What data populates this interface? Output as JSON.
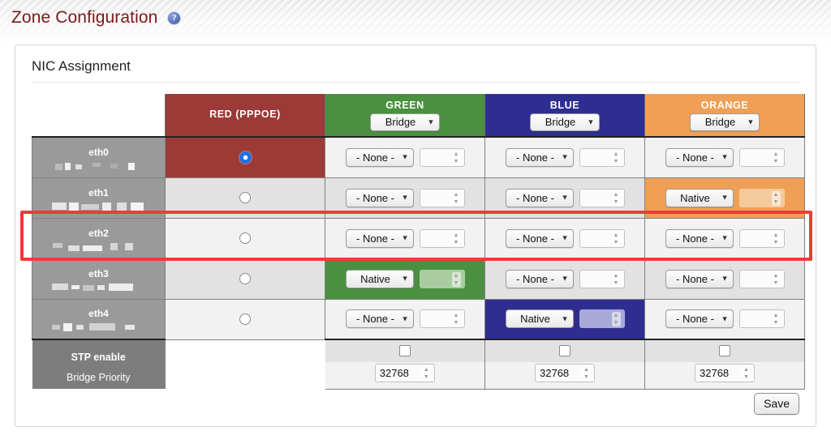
{
  "page": {
    "title": "Zone Configuration",
    "help_icon": "help-circle-icon"
  },
  "card": {
    "section_title": "NIC Assignment",
    "save_label": "Save"
  },
  "table": {
    "blank_header": "",
    "zones": [
      {
        "key": "red",
        "name": "RED (PPPOE)",
        "color": "#9c3a38",
        "has_mode_select": false,
        "mode_value": ""
      },
      {
        "key": "green",
        "name": "GREEN",
        "color": "#4a9040",
        "has_mode_select": true,
        "mode_value": "Bridge"
      },
      {
        "key": "blue",
        "name": "BLUE",
        "color": "#2e2e91",
        "has_mode_select": true,
        "mode_value": "Bridge"
      },
      {
        "key": "orange",
        "name": "ORANGE",
        "color": "#efa056",
        "has_mode_select": true,
        "mode_value": "Bridge"
      }
    ],
    "mode_options": [
      "Bridge"
    ],
    "vlan_options": [
      "- None -",
      "Native"
    ],
    "rows": [
      {
        "nic": "eth0",
        "mac_redacted": true,
        "red_selected": true,
        "green": {
          "select": "- None -",
          "vlan": "",
          "active": false
        },
        "blue": {
          "select": "- None -",
          "vlan": "",
          "active": false
        },
        "orange": {
          "select": "- None -",
          "vlan": "",
          "active": false
        }
      },
      {
        "nic": "eth1",
        "mac_redacted": true,
        "red_selected": false,
        "green": {
          "select": "- None -",
          "vlan": "",
          "active": false
        },
        "blue": {
          "select": "- None -",
          "vlan": "",
          "active": false
        },
        "orange": {
          "select": "Native",
          "vlan": "",
          "active": true
        }
      },
      {
        "nic": "eth2",
        "mac_redacted": true,
        "red_selected": false,
        "green": {
          "select": "- None -",
          "vlan": "",
          "active": false
        },
        "blue": {
          "select": "- None -",
          "vlan": "",
          "active": false
        },
        "orange": {
          "select": "- None -",
          "vlan": "",
          "active": false
        }
      },
      {
        "nic": "eth3",
        "mac_redacted": true,
        "red_selected": false,
        "green": {
          "select": "Native",
          "vlan": "",
          "active": true
        },
        "blue": {
          "select": "- None -",
          "vlan": "",
          "active": false
        },
        "orange": {
          "select": "- None -",
          "vlan": "",
          "active": false
        }
      },
      {
        "nic": "eth4",
        "mac_redacted": true,
        "red_selected": false,
        "green": {
          "select": "- None -",
          "vlan": "",
          "active": false
        },
        "blue": {
          "select": "Native",
          "vlan": "",
          "active": true
        },
        "orange": {
          "select": "- None -",
          "vlan": "",
          "active": false
        }
      }
    ],
    "stp": {
      "label": "STP enable",
      "green_checked": false,
      "blue_checked": false,
      "orange_checked": false
    },
    "bridge_priority": {
      "label": "Bridge Priority",
      "green_value": "32768",
      "blue_value": "32768",
      "orange_value": "32768"
    }
  },
  "annotation": {
    "highlight_row": "eth2",
    "color": "#ef3b36"
  }
}
